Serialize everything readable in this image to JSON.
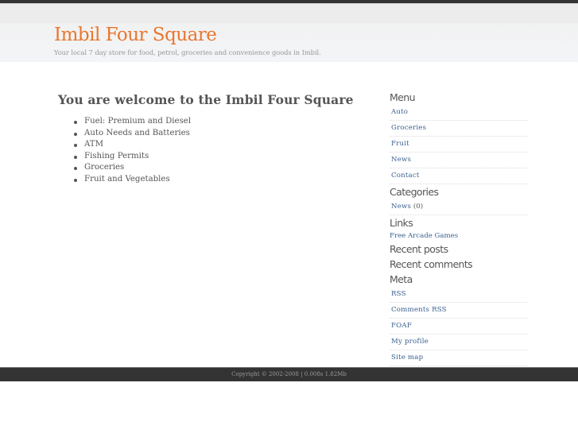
{
  "header": {
    "title": "Imbil Four Square",
    "tagline": "Your local 7 day store for food, petrol, groceries and convenience goods in Imbil."
  },
  "main": {
    "heading": "You are welcome to the Imbil Four Square",
    "features": [
      "Fuel: Premium and Diesel",
      "Auto Needs and Batteries",
      "ATM",
      "Fishing Permits",
      "Groceries",
      "Fruit and Vegetables"
    ]
  },
  "sidebar": {
    "menu": {
      "heading": "Menu",
      "items": [
        "Auto",
        "Groceries",
        "Fruit",
        "News",
        "Contact"
      ]
    },
    "categories": {
      "heading": "Categories",
      "items": [
        {
          "label": "News",
          "count": "(0)"
        }
      ]
    },
    "links": {
      "heading": "Links",
      "items": [
        "Free Arcade Games"
      ]
    },
    "recent_posts": {
      "heading": "Recent posts"
    },
    "recent_comments": {
      "heading": "Recent comments"
    },
    "meta": {
      "heading": "Meta",
      "items": [
        "RSS",
        "Comments RSS",
        "FOAF",
        "My profile",
        "Site map"
      ]
    }
  },
  "footer": {
    "text": "Copyright © 2002-2008 | 0.008s 1.82Mb"
  }
}
